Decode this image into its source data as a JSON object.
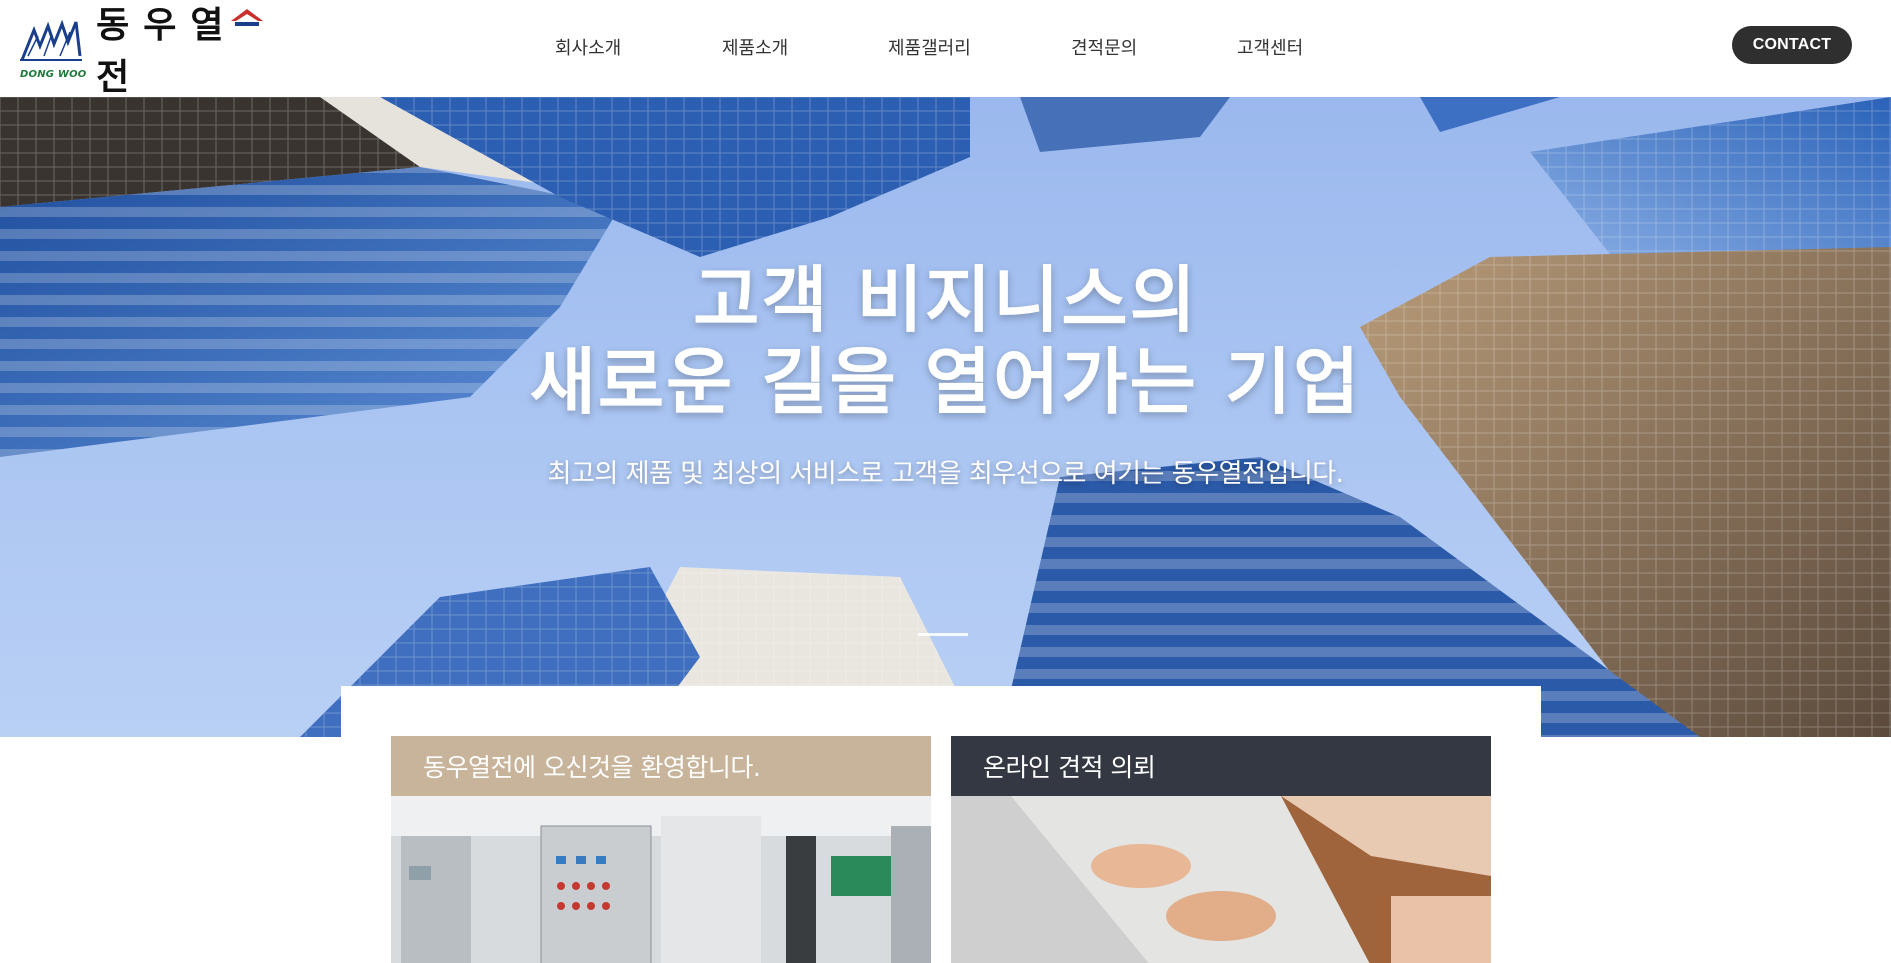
{
  "header": {
    "logo_text": "동우열전",
    "logo_sub": "DONG WOO",
    "nav": [
      "회사소개",
      "제품소개",
      "제품갤러리",
      "견적문의",
      "고객센터"
    ],
    "contact_label": "CONTACT"
  },
  "hero": {
    "title_line1": "고객 비지니스의",
    "title_line2": "새로운 길을 열어가는 기업",
    "subtitle": "최고의 제품 및 최상의 서비스로 고객을 최우선으로 여기는 동우열전입니다."
  },
  "cards": {
    "welcome_title": "동우열전에 오신것을 환영합니다.",
    "quote_title": "온라인 견적 의뢰"
  },
  "colors": {
    "contact_bg": "#2f2f2f",
    "welcome_bg": "#c8b49a",
    "quote_bg": "#333842",
    "sky": "#a9c4f2"
  }
}
